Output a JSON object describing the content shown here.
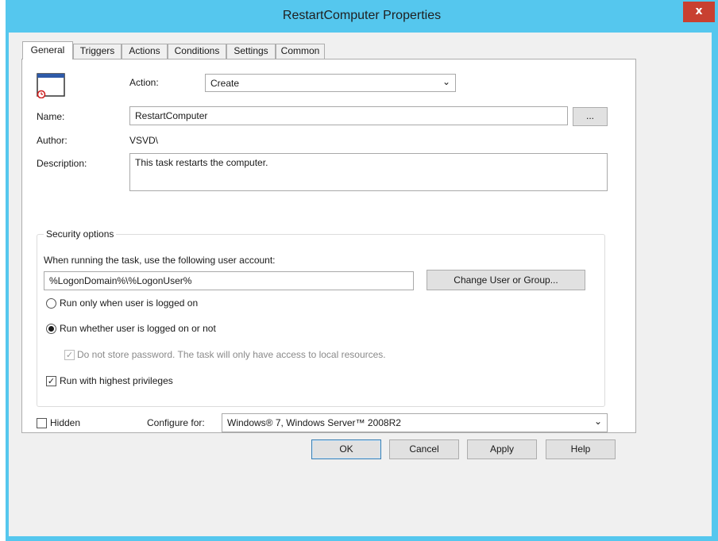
{
  "window": {
    "title": "RestartComputer Properties",
    "close_glyph": "x"
  },
  "tabs": [
    {
      "label": "General"
    },
    {
      "label": "Triggers"
    },
    {
      "label": "Actions"
    },
    {
      "label": "Conditions"
    },
    {
      "label": "Settings"
    },
    {
      "label": "Common"
    }
  ],
  "general": {
    "action_label": "Action:",
    "action_value": "Create",
    "name_label": "Name:",
    "name_value": "RestartComputer",
    "browse_label": "...",
    "author_label": "Author:",
    "author_value": "VSVD\\",
    "description_label": "Description:",
    "description_value": "This task restarts the computer."
  },
  "security": {
    "group_title": "Security options",
    "account_prompt": "When running the task, use the following user account:",
    "account_value": "%LogonDomain%\\%LogonUser%",
    "change_user_label": "Change User or Group...",
    "radio_logged_on": "Run only when user is logged on",
    "radio_whether": "Run whether user is logged on or not",
    "no_store_password": "Do not store password. The task will only have access to local resources.",
    "highest_privileges": "Run with highest privileges",
    "selected_option": "Run whether user is logged on or not"
  },
  "bottom": {
    "hidden_label": "Hidden",
    "configure_label": "Configure for:",
    "configure_value": "Windows® 7, Windows Server™ 2008R2"
  },
  "buttons": {
    "ok": "OK",
    "cancel": "Cancel",
    "apply": "Apply",
    "help": "Help"
  },
  "icons": {
    "close": "close-icon",
    "task": "task-window-icon",
    "dropdown": "chevron-down-icon",
    "check": "checkmark-icon"
  },
  "colors": {
    "titlebar": "#55c7ee",
    "close_button": "#c84031",
    "dialog": "#f0f0f0"
  }
}
